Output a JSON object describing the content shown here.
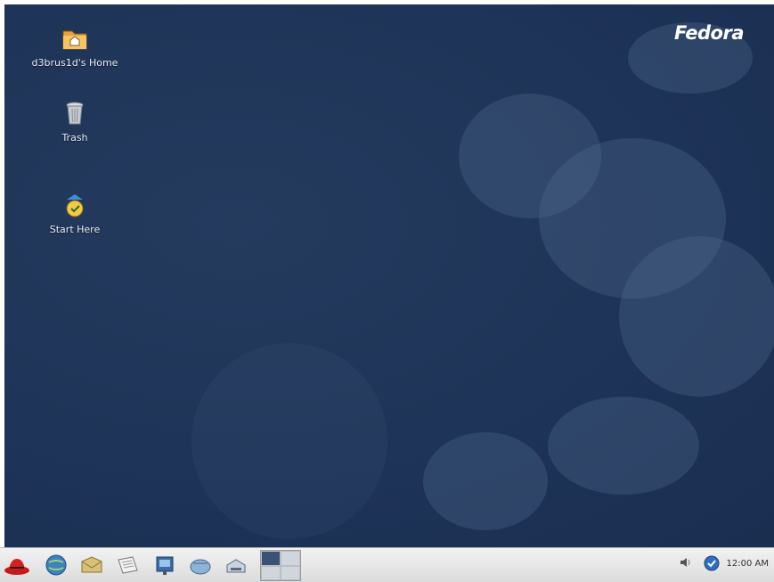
{
  "desktop": {
    "brand_text": "Fedora",
    "icons": [
      {
        "label": "d3brus1d's Home",
        "icon": "home-folder-icon"
      },
      {
        "label": "Trash",
        "icon": "trash-icon"
      },
      {
        "label": "Start Here",
        "icon": "start-here-icon"
      }
    ]
  },
  "panel": {
    "launchers": [
      {
        "icon": "redhat-main-menu-icon"
      },
      {
        "icon": "web-browser-icon"
      },
      {
        "icon": "email-icon"
      },
      {
        "icon": "office-writer-icon"
      },
      {
        "icon": "office-impress-icon"
      },
      {
        "icon": "office-calc-icon"
      },
      {
        "icon": "print-manager-icon"
      }
    ],
    "workspaces": {
      "count": 4,
      "active_index": 0
    },
    "tray": {
      "volume_icon": "volume-icon",
      "update_icon": "update-notifier-icon"
    },
    "clock": "12:00 AM"
  },
  "colors": {
    "desktop_bg": "#1d3357",
    "panel_bg": "#e6e6e6",
    "text": "#e6ecf5"
  }
}
